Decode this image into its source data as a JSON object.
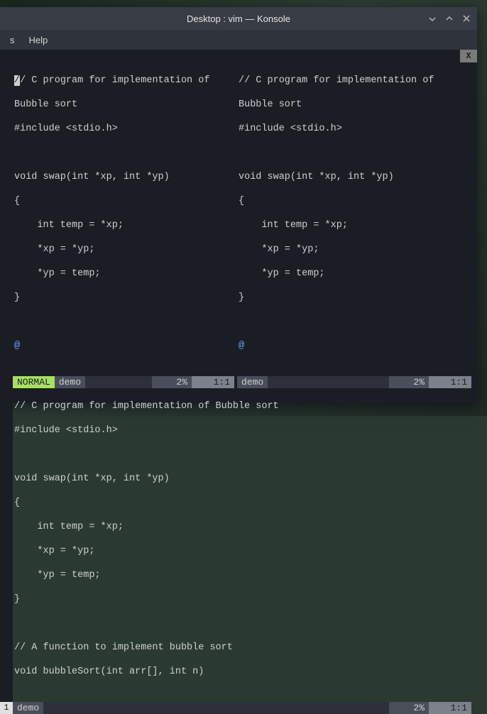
{
  "window": {
    "title": "Desktop : vim — Konsole"
  },
  "menubar": {
    "items": [
      "s",
      "Help"
    ]
  },
  "tabstrip": {
    "close_label": "X"
  },
  "panes": {
    "top_left": {
      "lines": [
        "// C program for implementation of",
        "Bubble sort",
        "#include <stdio.h>",
        "",
        "void swap(int *xp, int *yp)",
        "{",
        "    int temp = *xp;",
        "    *xp = *yp;",
        "    *yp = temp;",
        "}",
        ""
      ],
      "at": "@",
      "status": {
        "mode": "NORMAL",
        "file": "demo",
        "percent": "2%",
        "pos": "1:1"
      }
    },
    "top_right": {
      "lines": [
        "// C program for implementation of",
        "Bubble sort",
        "#include <stdio.h>",
        "",
        "void swap(int *xp, int *yp)",
        "{",
        "    int temp = *xp;",
        "    *xp = *yp;",
        "    *yp = temp;",
        "}",
        ""
      ],
      "at": "@",
      "status": {
        "file": "demo",
        "percent": "2%",
        "pos": "1:1"
      }
    },
    "bottom": {
      "lines": [
        "// C program for implementation of Bubble sort",
        "#include <stdio.h>",
        "",
        "void swap(int *xp, int *yp)",
        "{",
        "    int temp = *xp;",
        "    *xp = *yp;",
        "    *yp = temp;",
        "}",
        "",
        "// A function to implement bubble sort",
        "void bubbleSort(int arr[], int n)"
      ],
      "status": {
        "gutter": "1",
        "file": "demo",
        "percent": "2%",
        "pos": "1:1"
      }
    }
  }
}
